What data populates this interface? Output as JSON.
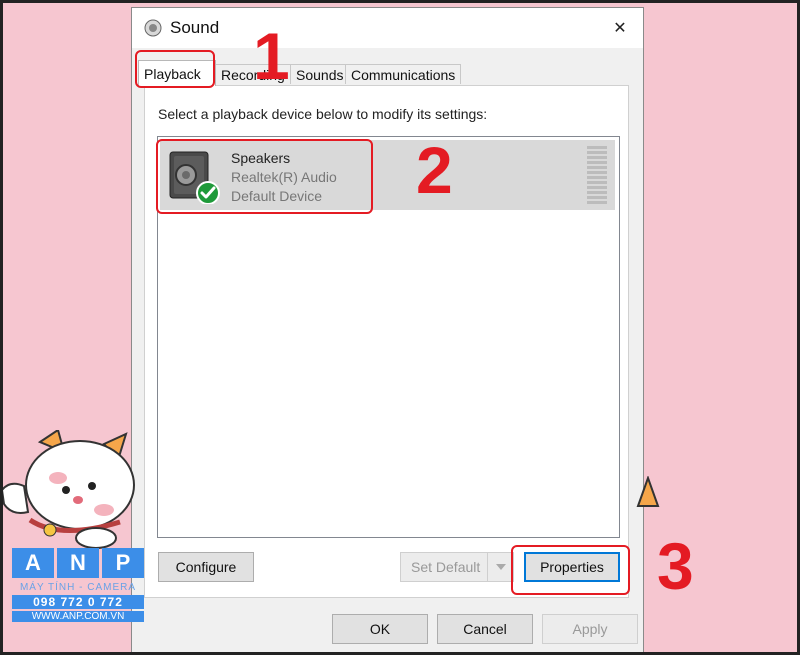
{
  "window": {
    "title": "Sound",
    "close_glyph": "✕"
  },
  "tabs": [
    {
      "label": "Playback",
      "active": true
    },
    {
      "label": "Recording",
      "active": false
    },
    {
      "label": "Sounds",
      "active": false
    },
    {
      "label": "Communications",
      "active": false
    }
  ],
  "panel": {
    "instruction": "Select a playback device below to modify its settings:",
    "device": {
      "name": "Speakers",
      "driver": "Realtek(R) Audio",
      "status": "Default Device",
      "icon": "speaker-icon",
      "status_icon": "green-check-icon"
    },
    "buttons": {
      "configure": "Configure",
      "set_default": "Set Default",
      "properties": "Properties"
    }
  },
  "footer": {
    "ok": "OK",
    "cancel": "Cancel",
    "apply": "Apply"
  },
  "annotations": {
    "step1": "1",
    "step2": "2",
    "step3": "3"
  },
  "watermark": {
    "letters": [
      "A",
      "N",
      "P"
    ],
    "tagline": "MÁY TÍNH - CAMERA",
    "phone": "098 772 0 772",
    "website": "WWW.ANP.COM.VN"
  },
  "colors": {
    "annotation": "#e41b23",
    "background": "#f6c6d0",
    "focus": "#0078d7",
    "selection": "#d9d9d9"
  }
}
